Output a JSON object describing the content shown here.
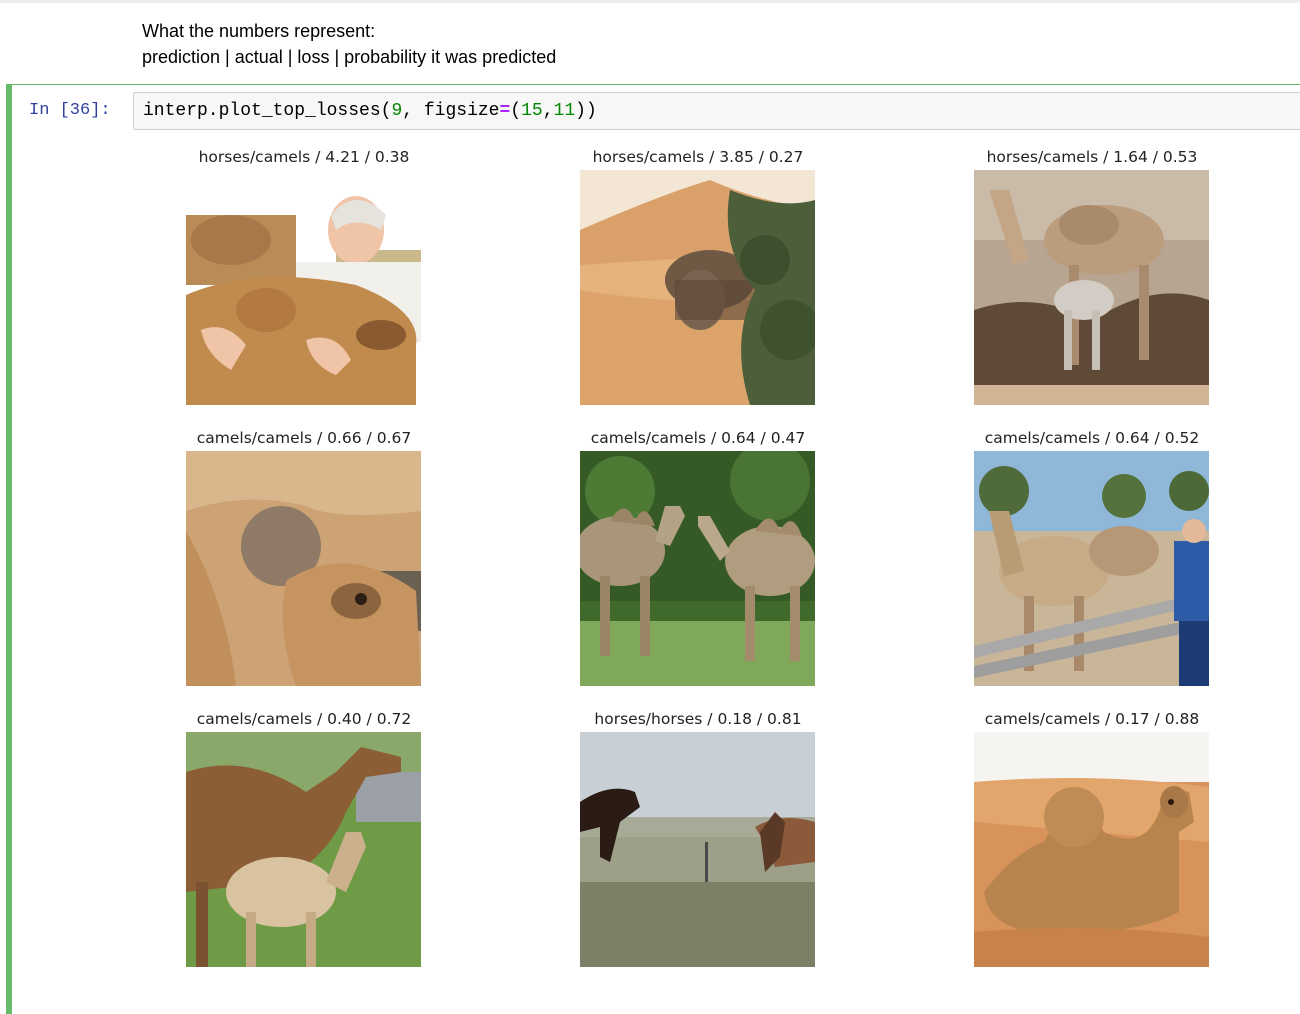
{
  "markdown": {
    "line1": "What the numbers represent:",
    "line2": "prediction | actual | loss | probability it was predicted"
  },
  "code_cell": {
    "prompt": "In [36]:",
    "code": {
      "t1": "interp.plot_top_losses(",
      "n1": "9",
      "t2": ", figsize",
      "op": "=",
      "t3": "(",
      "n2": "15",
      "t4": ",",
      "n3": "11",
      "t5": "))"
    }
  },
  "output": {
    "panels": [
      {
        "title": "horses/camels / 4.21 / 0.38",
        "image": "man-hugging-camel-photo"
      },
      {
        "title": "horses/camels / 3.85 / 0.27",
        "image": "camel-behind-tree-in-desert-photo"
      },
      {
        "title": "horses/camels / 1.64 / 0.53",
        "image": "camel-with-calf-photo"
      },
      {
        "title": "camels/camels / 0.66 / 0.67",
        "image": "calf-nursing-photo"
      },
      {
        "title": "camels/camels / 0.64 / 0.47",
        "image": "two-bactrian-camels-photo"
      },
      {
        "title": "camels/camels / 0.64 / 0.52",
        "image": "man-with-camels-at-fence-photo"
      },
      {
        "title": "camels/camels / 0.40 / 0.72",
        "image": "camel-and-calf-on-grass-photo"
      },
      {
        "title": "horses/horses / 0.18 / 0.81",
        "image": "running-horses-photo"
      },
      {
        "title": "camels/camels / 0.17 / 0.88",
        "image": "camel-resting-on-sand-photo"
      }
    ]
  },
  "colors": {
    "cell_border": "#66bb6a",
    "prompt": "#303f9f",
    "number": "#008800",
    "operator": "#aa22ff"
  }
}
